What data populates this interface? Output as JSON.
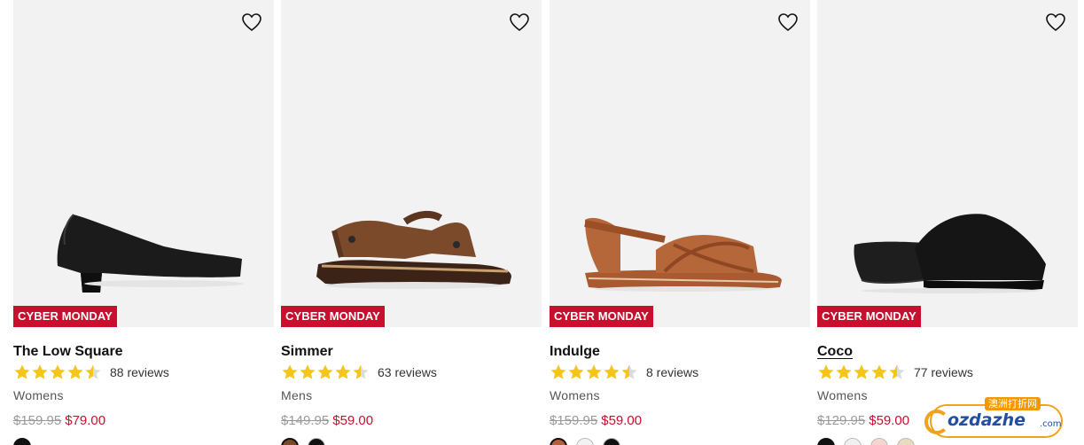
{
  "products": [
    {
      "name": "The Low Square",
      "badge": "CYBER MONDAY",
      "rating": 4.5,
      "reviews": "88 reviews",
      "category": "Womens",
      "was_price": "$159.95",
      "now_price": "$79.00",
      "shoe_type": "black-pump",
      "swatch_colors": [
        "#111111"
      ]
    },
    {
      "name": "Simmer",
      "badge": "CYBER MONDAY",
      "rating": 4.5,
      "reviews": "63 reviews",
      "category": "Mens",
      "was_price": "$149.95",
      "now_price": "$59.00",
      "shoe_type": "brown-sport-sandal",
      "swatch_colors": [
        "#7a4a2a",
        "#111111"
      ]
    },
    {
      "name": "Indulge",
      "badge": "CYBER MONDAY",
      "rating": 4.5,
      "reviews": "8 reviews",
      "category": "Womens",
      "was_price": "$159.95",
      "now_price": "$59.00",
      "shoe_type": "tan-cross-sandal",
      "swatch_colors": [
        "#b5603a",
        "#f2f2f2",
        "#111111"
      ]
    },
    {
      "name": "Coco",
      "badge": "CYBER MONDAY",
      "rating": 4.5,
      "reviews": "77 reviews",
      "category": "Womens",
      "was_price": "$129.95",
      "now_price": "$59.00",
      "shoe_type": "black-slide-wedge",
      "swatch_colors": [
        "#111111",
        "#f0f0f0",
        "#f3d6cf",
        "#e8dcc0"
      ]
    }
  ],
  "watermark": {
    "brand": "ozdazhe",
    "suffix": ".com",
    "tag": "澳洲打折网"
  },
  "colors": {
    "badge_bg": "#c8102e",
    "sale_price": "#c8102e",
    "star": "#f5c518",
    "image_bg": "#f2f2f2"
  },
  "icons": {
    "wishlist": "heart-outline-icon",
    "rating": "star-icon"
  }
}
